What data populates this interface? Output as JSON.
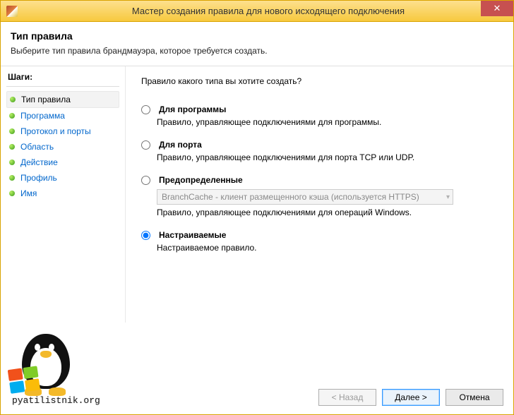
{
  "titlebar": {
    "title": "Мастер создания правила для нового исходящего подключения",
    "close_glyph": "✕"
  },
  "header": {
    "title": "Тип правила",
    "subtitle": "Выберите тип правила брандмауэра, которое требуется создать."
  },
  "sidebar": {
    "title": "Шаги:",
    "steps": [
      {
        "label": "Тип правила",
        "current": true
      },
      {
        "label": "Программа",
        "current": false
      },
      {
        "label": "Протокол и порты",
        "current": false
      },
      {
        "label": "Область",
        "current": false
      },
      {
        "label": "Действие",
        "current": false
      },
      {
        "label": "Профиль",
        "current": false
      },
      {
        "label": "Имя",
        "current": false
      }
    ]
  },
  "main": {
    "question": "Правило какого типа вы хотите создать?",
    "options": [
      {
        "id": "program",
        "label": "Для программы",
        "desc": "Правило, управляющее подключениями для программы.",
        "selected": false
      },
      {
        "id": "port",
        "label": "Для порта",
        "desc": "Правило, управляющее подключениями для порта TCP или UDP.",
        "selected": false
      },
      {
        "id": "predef",
        "label": "Предопределенные",
        "desc": "Правило, управляющее подключениями для операций Windows.",
        "selected": false,
        "combo_value": "BranchCache - клиент размещенного кэша (используется HTTPS)"
      },
      {
        "id": "custom",
        "label": "Настраиваемые",
        "desc": "Настраиваемое правило.",
        "selected": true
      }
    ]
  },
  "footer": {
    "logo_text": "pyatilistnik.org",
    "back": "< Назад",
    "next": "Далее >",
    "cancel": "Отмена"
  }
}
